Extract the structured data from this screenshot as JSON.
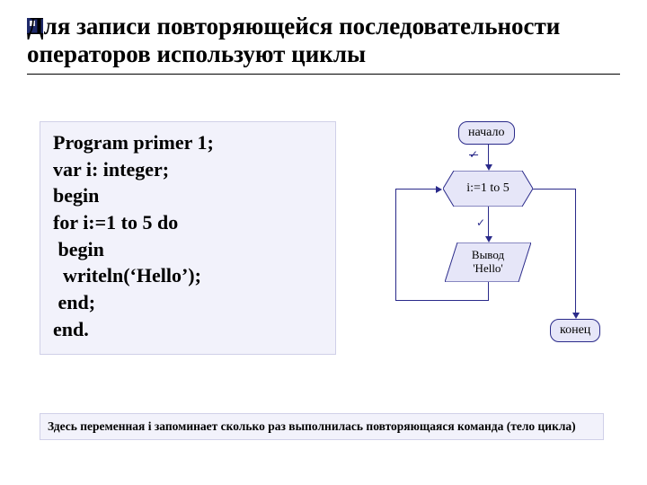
{
  "title": "Для  записи повторяющейся последовательности операторов используют циклы",
  "code": {
    "l1": "Program primer 1;",
    "l2": "var i: integer;",
    "l3": "begin",
    "l4": "for i:=1 to 5 do",
    "l5": " begin",
    "l6": "  writeln(‘Hello’);",
    "l7": " end;",
    "l8": "end."
  },
  "flow": {
    "start": "начало",
    "loop": "i:=1 to 5",
    "output_l1": "Вывод",
    "output_l2": "'Hello'",
    "end": "конец",
    "mark_true": "✓",
    "mark_false": "✓"
  },
  "footnote": "Здесь переменная i запоминает сколько раз выполнилась повторяющаяся команда (тело цикла)"
}
